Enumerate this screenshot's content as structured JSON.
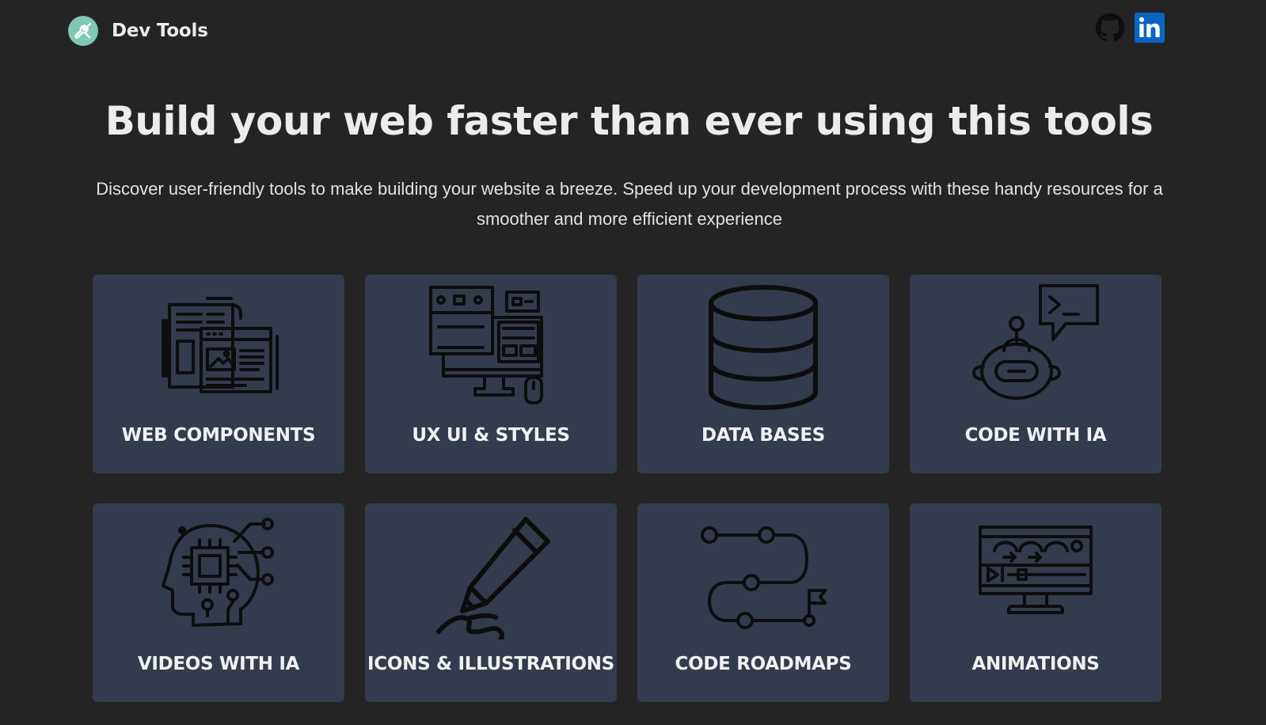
{
  "header": {
    "brand_name": "Dev Tools",
    "logo_icon": "wrench-screwdriver-icon",
    "social": [
      {
        "name": "GitHub",
        "icon": "github-icon"
      },
      {
        "name": "LinkedIn",
        "icon": "linkedin-icon"
      }
    ]
  },
  "hero": {
    "title": "Build your web faster than ever using this tools",
    "subtitle": "Discover user-friendly tools to make building your website a breeze. Speed up your development process with these handy resources for a smoother and more efficient experience"
  },
  "categories": [
    {
      "label": "WEB COMPONENTS",
      "icon": "web-components-icon"
    },
    {
      "label": "UX UI & STYLES",
      "icon": "ux-ui-styles-icon"
    },
    {
      "label": "DATA BASES",
      "icon": "database-icon"
    },
    {
      "label": "CODE WITH IA",
      "icon": "ai-robot-terminal-icon"
    },
    {
      "label": "VIDEOS WITH IA",
      "icon": "ai-head-chip-icon"
    },
    {
      "label": "ICONS & ILLUSTRATIONS",
      "icon": "pencil-icon"
    },
    {
      "label": "CODE ROADMAPS",
      "icon": "roadmap-icon"
    },
    {
      "label": "ANIMATIONS",
      "icon": "animation-monitor-icon"
    }
  ],
  "colors": {
    "background": "#242424",
    "card": "#343b4d",
    "logo": "#7ec8b4",
    "linkedin": "#0a66c2",
    "text": "#ececec"
  }
}
